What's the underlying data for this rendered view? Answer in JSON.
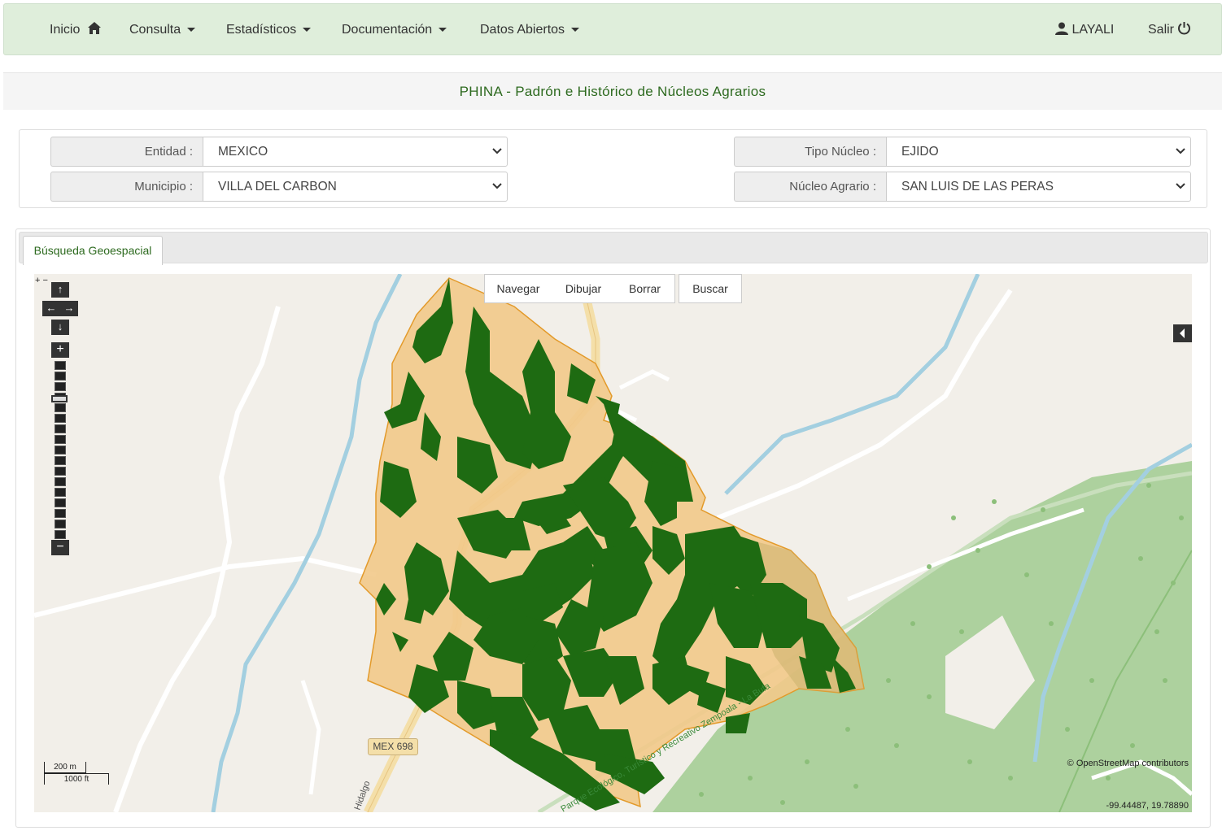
{
  "navbar": {
    "inicio": "Inicio",
    "consulta": "Consulta",
    "estadisticos": "Estadísticos",
    "documentacion": "Documentación",
    "datos_abiertos": "Datos Abiertos",
    "user": "LAYALI",
    "salir": "Salir",
    "icons": [
      "home-icon",
      "user-icon",
      "power-icon",
      "caret-down-icon"
    ]
  },
  "title": "PHINA - Padrón e Histórico de Núcleos Agrarios",
  "filters": {
    "entidad": {
      "label": "Entidad :",
      "value": "MEXICO"
    },
    "municipio": {
      "label": "Municipio :",
      "value": "VILLA DEL CARBON"
    },
    "tipo_nucleo": {
      "label": "Tipo Núcleo :",
      "value": "EJIDO"
    },
    "nucleo_agrario": {
      "label": "Núcleo Agrario :",
      "value": "SAN LUIS DE LAS PERAS"
    }
  },
  "tabs": [
    {
      "label": "Búsqueda Geoespacial"
    }
  ],
  "map": {
    "toolbar": {
      "navegar": "Navegar",
      "dibujar": "Dibujar",
      "borrar": "Borrar",
      "buscar": "Buscar"
    },
    "zoom_plus": "+",
    "zoom_minus": "−",
    "mini_zoom": "+ −",
    "scale_metric": "200 m",
    "scale_imperial": "1000 ft",
    "attribution": "© OpenStreetMap contributors",
    "coordinates": "-99.44487, 19.78890",
    "road_label": "MEX 698",
    "street_label_1": "Hidalgo",
    "street_label_2": "Parque Ecológico, Turístico y Recreativo Zempoala - La Bufa",
    "colors": {
      "parcel_fill": "#f2c98a",
      "parcel_stroke": "#e39a2a",
      "forest": "#1e6b12",
      "water": "#a3cfe0",
      "park": "#add19e"
    }
  }
}
